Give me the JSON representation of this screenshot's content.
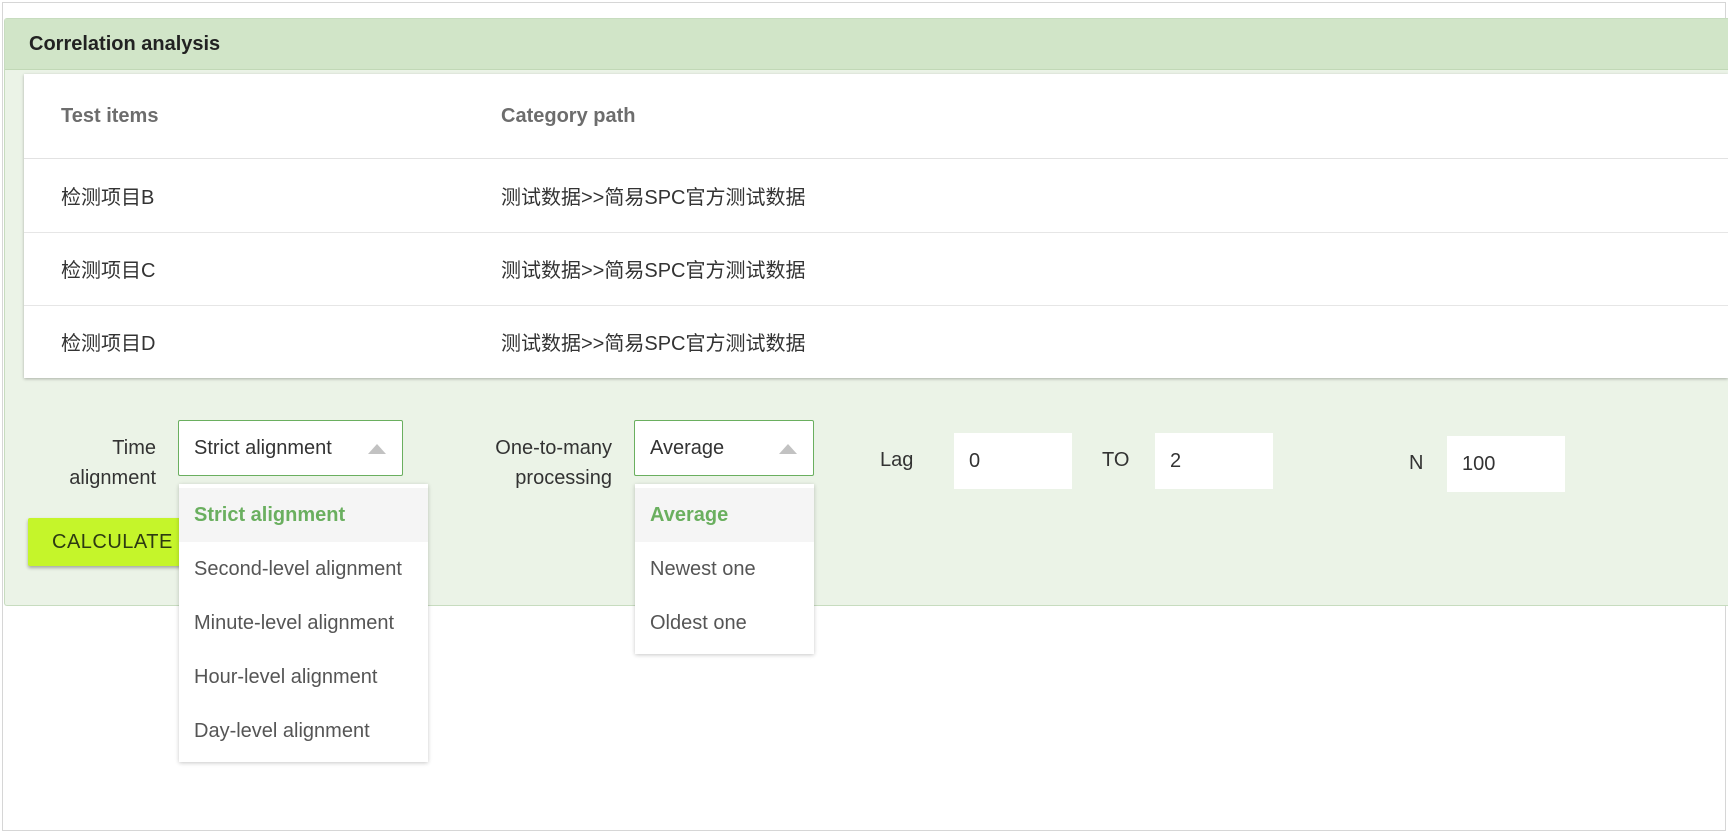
{
  "panel": {
    "title": "Correlation analysis"
  },
  "table": {
    "headers": [
      "Test items",
      "Category path"
    ],
    "rows": [
      {
        "item": "检测项目B",
        "path": "测试数据>>简易SPC官方测试数据"
      },
      {
        "item": "检测项目C",
        "path": "测试数据>>简易SPC官方测试数据"
      },
      {
        "item": "检测项目D",
        "path": "测试数据>>简易SPC官方测试数据"
      }
    ]
  },
  "controls": {
    "time_alignment": {
      "label_line1": "Time",
      "label_line2": "alignment",
      "selected": "Strict alignment",
      "options": [
        "Strict alignment",
        "Second-level alignment",
        "Minute-level alignment",
        "Hour-level alignment",
        "Day-level alignment"
      ]
    },
    "one_to_many": {
      "label_line1": "One-to-many",
      "label_line2": "processing",
      "selected": "Average",
      "options": [
        "Average",
        "Newest one",
        "Oldest one"
      ]
    },
    "lag": {
      "label": "Lag",
      "value": "0"
    },
    "to": {
      "label": "TO",
      "value": "2"
    },
    "n": {
      "label": "N",
      "value": "100"
    },
    "calculate_label": "CALCULATE"
  },
  "colors": {
    "accent": "#6aaf5f",
    "header_bg": "#d1e5c8",
    "panel_bg": "#ebf3e7",
    "button_bg": "#c5f52a"
  }
}
